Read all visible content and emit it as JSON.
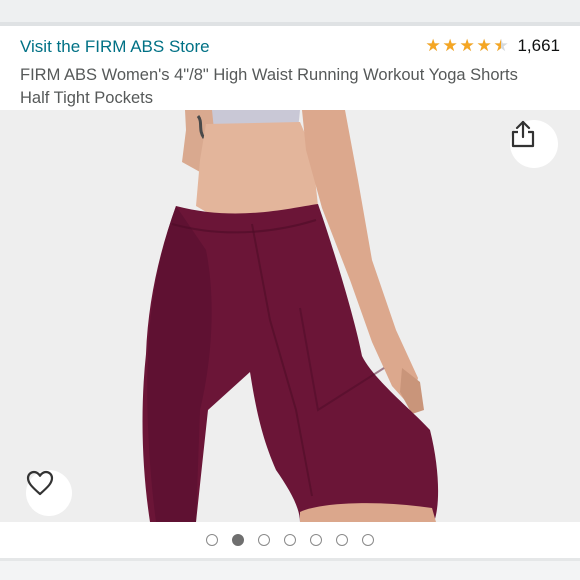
{
  "header": {
    "store_link": "Visit the FIRM ABS Store",
    "rating_value": 4.5,
    "rating_count": "1,661",
    "product_title": "FIRM ABS Women's 4\"/8\" High Waist Running Workout Yoga Shorts Half Tight Pockets"
  },
  "image": {
    "total_images": 7,
    "active_index": 1,
    "background": "#eeeeee",
    "product_color": "#6b1537"
  },
  "icons": {
    "share": "share-icon",
    "wishlist": "heart-icon",
    "star": "star-icon"
  },
  "colors": {
    "link": "#007185",
    "star": "#f5a623",
    "text": "#565959"
  }
}
